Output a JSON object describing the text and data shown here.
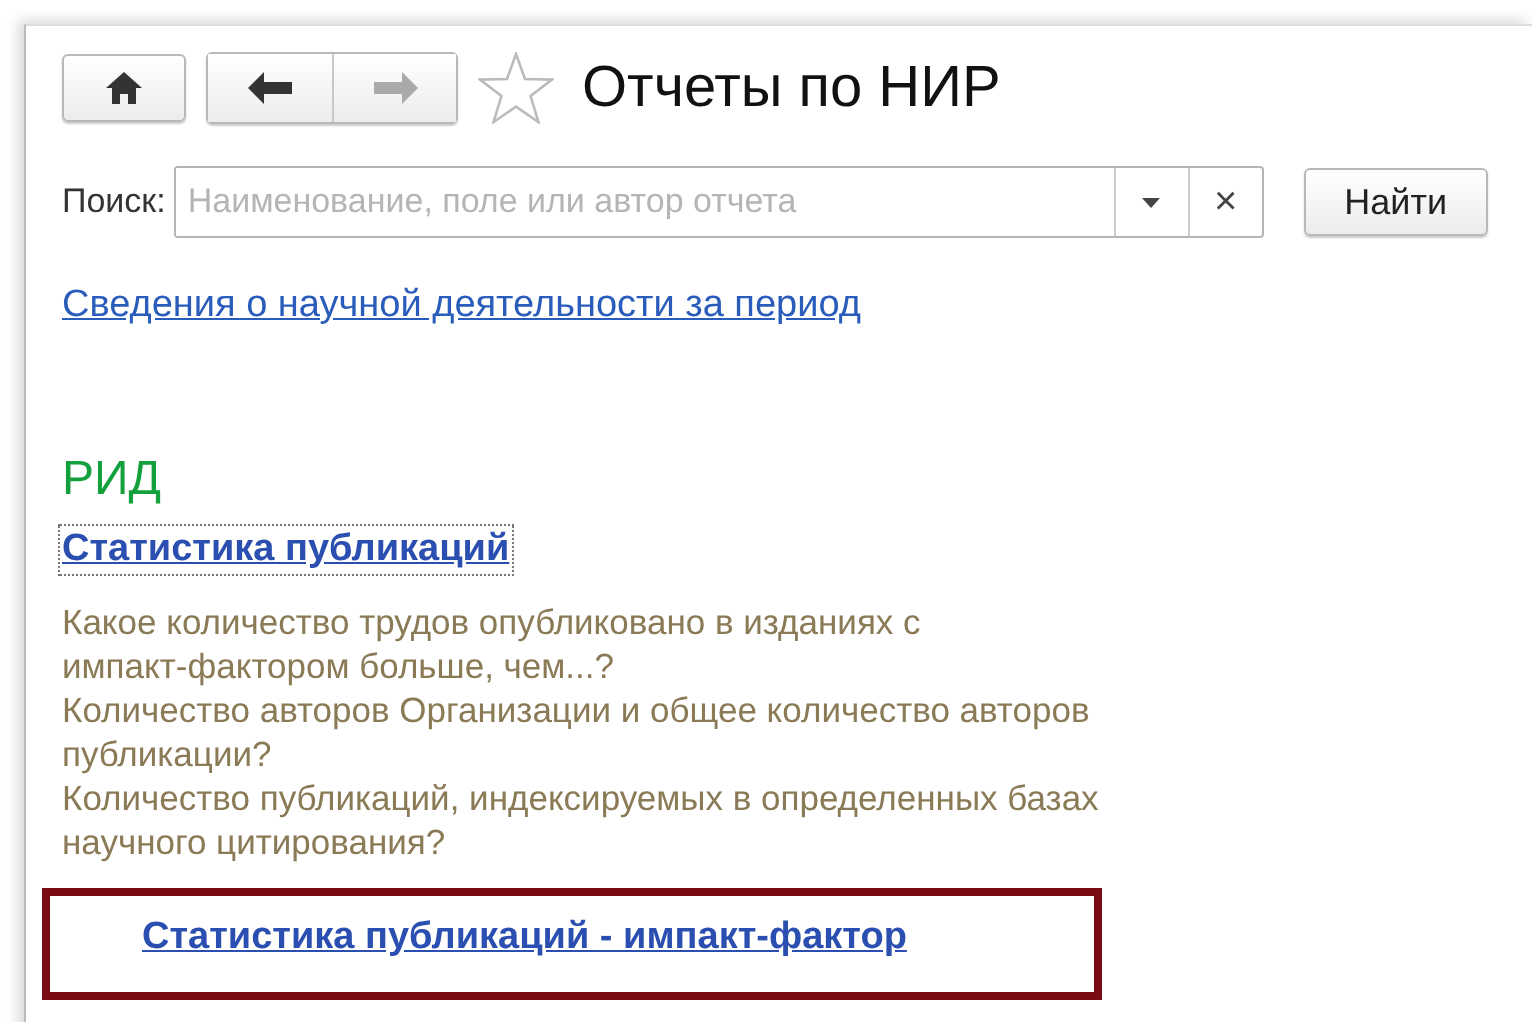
{
  "window": {
    "title": "Отчеты по НИР",
    "favorite": false
  },
  "search": {
    "label": "Поиск:",
    "placeholder": "Наименование, поле или автор отчета",
    "clear": "×",
    "button": "Найти"
  },
  "top_link": "Сведения о научной деятельности за период",
  "section": {
    "title": "РИД",
    "reports": [
      {
        "title": "Статистика публикаций",
        "focused": true,
        "highlighted": false,
        "description": [
          "Какое количество трудов опубликовано в изданиях с",
          "импакт-фактором больше, чем...?",
          "Количество авторов Организации и общее количество авторов",
          "публикации?",
          "Количество публикаций, индексируемых в определенных базах",
          "научного цитирования?"
        ]
      },
      {
        "title": "Статистика публикаций - импакт-фактор",
        "focused": false,
        "highlighted": true
      }
    ]
  }
}
